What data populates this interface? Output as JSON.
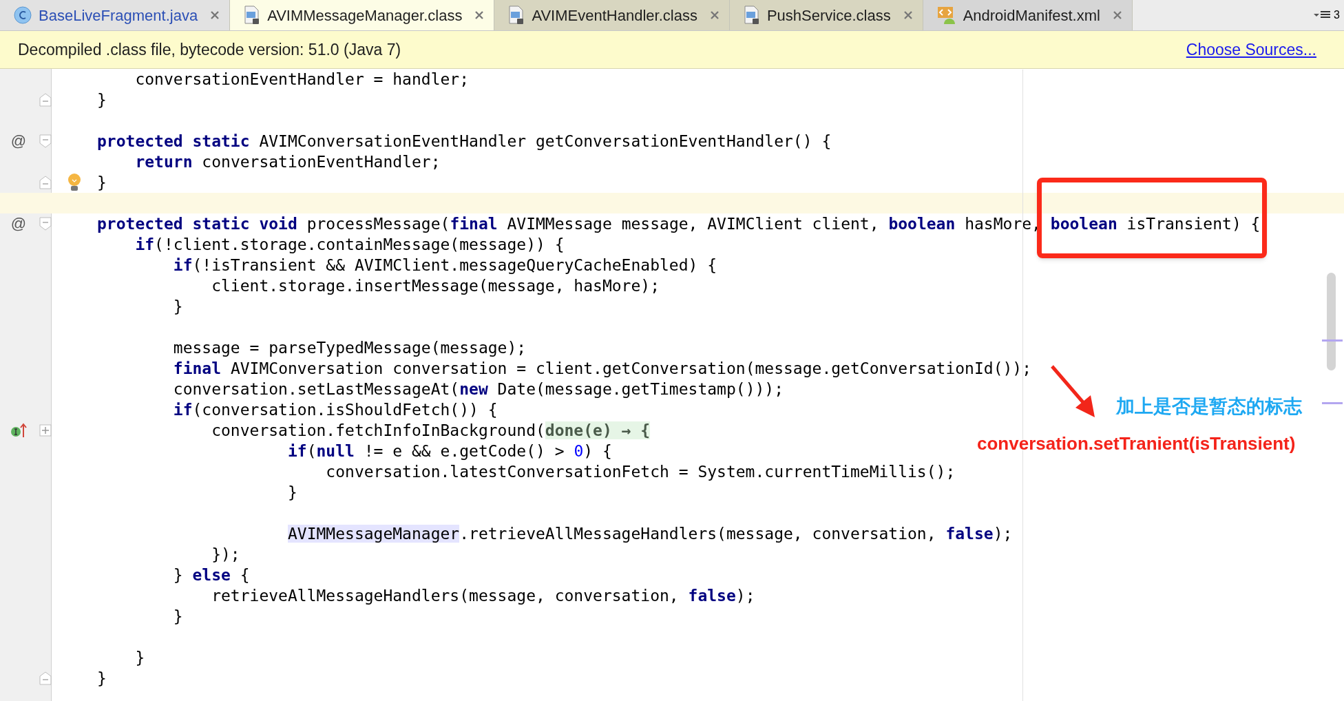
{
  "tabs": [
    {
      "label": "BaseLiveFragment.java",
      "kind": "java",
      "selected": false,
      "color": "#2b4fb5"
    },
    {
      "label": "AVIMMessageManager.class",
      "kind": "class",
      "selected": true,
      "color": "#1e1e1e"
    },
    {
      "label": "AVIMEventHandler.class",
      "kind": "class",
      "selected": false,
      "color": "#1e1e1e"
    },
    {
      "label": "PushService.class",
      "kind": "class",
      "selected": false,
      "color": "#1e1e1e"
    },
    {
      "label": "AndroidManifest.xml",
      "kind": "xml",
      "selected": false,
      "color": "#1e1e1e"
    }
  ],
  "tab_overflow": {
    "count": "3"
  },
  "banner": {
    "message": "Decompiled .class file, bytecode version: 51.0 (Java 7)",
    "link": "Choose Sources..."
  },
  "code_lines": [
    {
      "kind": "code",
      "tokens": [
        {
          "kind": "plain",
          "text": "    conversationEventHandler = handler;"
        }
      ]
    },
    {
      "kind": "code",
      "fold_end": true,
      "tokens": [
        {
          "kind": "plain",
          "text": "}"
        }
      ]
    },
    {
      "kind": "blank"
    },
    {
      "kind": "code",
      "gutter_mark": "@",
      "fold_start": true,
      "tokens": [
        {
          "kind": "keyword",
          "text": "protected static"
        },
        {
          "kind": "plain",
          "text": " AVIMConversationEventHandler getConversationEventHandler() {"
        }
      ]
    },
    {
      "kind": "code",
      "tokens": [
        {
          "kind": "keyword",
          "text": "    return"
        },
        {
          "kind": "plain",
          "text": " conversationEventHandler;"
        }
      ]
    },
    {
      "kind": "code",
      "fold_end": true,
      "bulb": true,
      "tokens": [
        {
          "kind": "plain",
          "text": "}"
        }
      ]
    },
    {
      "kind": "blank",
      "current": true
    },
    {
      "kind": "code",
      "gutter_mark": "@",
      "fold_start": true,
      "tokens": [
        {
          "kind": "keyword",
          "text": "protected static void"
        },
        {
          "kind": "plain",
          "text": " processMessage("
        },
        {
          "kind": "keyword",
          "text": "final"
        },
        {
          "kind": "plain",
          "text": " AVIMMessage message, AVIMClient client, "
        },
        {
          "kind": "keyword",
          "text": "boolean"
        },
        {
          "kind": "plain",
          "text": " hasMore, "
        },
        {
          "kind": "keyword",
          "text": "boolean"
        },
        {
          "kind": "plain",
          "text": " isTransient) {"
        }
      ]
    },
    {
      "kind": "code",
      "tokens": [
        {
          "kind": "keyword",
          "text": "    if"
        },
        {
          "kind": "plain",
          "text": "(!client.storage.containMessage(message)) {"
        }
      ]
    },
    {
      "kind": "code",
      "tokens": [
        {
          "kind": "keyword",
          "text": "        if"
        },
        {
          "kind": "plain",
          "text": "(!isTransient && AVIMClient.messageQueryCacheEnabled) {"
        }
      ]
    },
    {
      "kind": "code",
      "tokens": [
        {
          "kind": "plain",
          "text": "            client.storage.insertMessage(message, hasMore);"
        }
      ]
    },
    {
      "kind": "code",
      "tokens": [
        {
          "kind": "plain",
          "text": "        }"
        }
      ]
    },
    {
      "kind": "blank"
    },
    {
      "kind": "code",
      "tokens": [
        {
          "kind": "plain",
          "text": "        message = parseTypedMessage(message);"
        }
      ]
    },
    {
      "kind": "code",
      "tokens": [
        {
          "kind": "keyword",
          "text": "        final"
        },
        {
          "kind": "plain",
          "text": " AVIMConversation conversation = client.getConversation(message.getConversationId());"
        }
      ]
    },
    {
      "kind": "code",
      "tokens": [
        {
          "kind": "plain",
          "text": "        conversation.setLastMessageAt("
        },
        {
          "kind": "keyword",
          "text": "new"
        },
        {
          "kind": "plain",
          "text": " Date(message.getTimestamp()));"
        }
      ]
    },
    {
      "kind": "code",
      "tokens": [
        {
          "kind": "keyword",
          "text": "        if"
        },
        {
          "kind": "plain",
          "text": "(conversation.isShouldFetch()) {"
        }
      ]
    },
    {
      "kind": "code",
      "implements": true,
      "collapsed": true,
      "tokens": [
        {
          "kind": "plain",
          "text": "            conversation.fetchInfoInBackground("
        },
        {
          "kind": "folded",
          "text": "done(e) → {"
        }
      ]
    },
    {
      "kind": "code",
      "tokens": [
        {
          "kind": "keyword",
          "text": "                    if"
        },
        {
          "kind": "plain",
          "text": "("
        },
        {
          "kind": "keyword",
          "text": "null"
        },
        {
          "kind": "plain",
          "text": " != e && e.getCode() > "
        },
        {
          "kind": "number",
          "text": "0"
        },
        {
          "kind": "plain",
          "text": ") {"
        }
      ]
    },
    {
      "kind": "code",
      "tokens": [
        {
          "kind": "plain",
          "text": "                        conversation.latestConversationFetch = System.currentTimeMillis();"
        }
      ]
    },
    {
      "kind": "code",
      "tokens": [
        {
          "kind": "plain",
          "text": "                    }"
        }
      ]
    },
    {
      "kind": "blank"
    },
    {
      "kind": "code",
      "tokens": [
        {
          "kind": "highlight",
          "text": "                    AVIMMessageManager"
        },
        {
          "kind": "plain",
          "text": ".retrieveAllMessageHandlers(message, conversation, "
        },
        {
          "kind": "keyword",
          "text": "false"
        },
        {
          "kind": "plain",
          "text": ");"
        }
      ]
    },
    {
      "kind": "code",
      "tokens": [
        {
          "kind": "plain",
          "text": "            });"
        }
      ]
    },
    {
      "kind": "code",
      "tokens": [
        {
          "kind": "plain",
          "text": "        } "
        },
        {
          "kind": "keyword",
          "text": "else"
        },
        {
          "kind": "plain",
          "text": " {"
        }
      ]
    },
    {
      "kind": "code",
      "tokens": [
        {
          "kind": "plain",
          "text": "            retrieveAllMessageHandlers(message, conversation, "
        },
        {
          "kind": "keyword",
          "text": "false"
        },
        {
          "kind": "plain",
          "text": ");"
        }
      ]
    },
    {
      "kind": "code",
      "tokens": [
        {
          "kind": "plain",
          "text": "        }"
        }
      ]
    },
    {
      "kind": "blank"
    },
    {
      "kind": "code",
      "tokens": [
        {
          "kind": "plain",
          "text": "    }"
        }
      ]
    },
    {
      "kind": "code",
      "fold_end": true,
      "tokens": [
        {
          "kind": "plain",
          "text": "}"
        }
      ]
    }
  ],
  "annotations": [
    {
      "kind": "note",
      "text": "加上是否是暂态的标志"
    },
    {
      "kind": "code",
      "text": "conversation.setTranient(isTransient)"
    }
  ]
}
